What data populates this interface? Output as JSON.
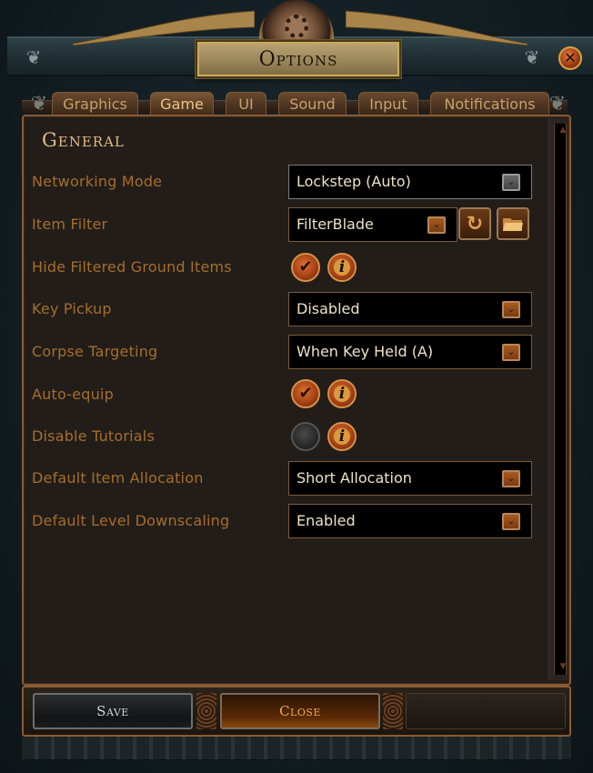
{
  "window": {
    "title": "Options",
    "close_icon": "close-x-icon"
  },
  "tabs": [
    {
      "label": "Graphics",
      "active": false
    },
    {
      "label": "Game",
      "active": true
    },
    {
      "label": "UI",
      "active": false
    },
    {
      "label": "Sound",
      "active": false
    },
    {
      "label": "Input",
      "active": false
    },
    {
      "label": "Notifications",
      "active": false
    }
  ],
  "section": {
    "title": "General"
  },
  "settings": [
    {
      "label": "Networking Mode",
      "type": "dropdown",
      "value": "Lockstep (Auto)",
      "enabled": false
    },
    {
      "label": "Item Filter",
      "type": "dropdown",
      "value": "FilterBlade",
      "enabled": true,
      "extra_buttons": [
        "reload-icon",
        "folder-icon"
      ]
    },
    {
      "label": "Hide Filtered Ground Items",
      "type": "checkbox",
      "checked": true
    },
    {
      "label": "Key Pickup",
      "type": "dropdown",
      "value": "Disabled",
      "enabled": true
    },
    {
      "label": "Corpse Targeting",
      "type": "dropdown",
      "value": "When Key Held (A)",
      "enabled": true
    },
    {
      "label": "Auto-equip",
      "type": "checkbox",
      "checked": true
    },
    {
      "label": "Disable Tutorials",
      "type": "checkbox",
      "checked": false
    },
    {
      "label": "Default Item Allocation",
      "type": "dropdown",
      "value": "Short Allocation",
      "enabled": true
    },
    {
      "label": "Default Level Downscaling",
      "type": "dropdown",
      "value": "Enabled",
      "enabled": true
    }
  ],
  "glyphs": {
    "check": "✔",
    "info": "i",
    "arrow": "⌄",
    "reload": "↻",
    "folder": "📂",
    "close": "✕",
    "scroll_up": "▲",
    "scroll_down": "▼",
    "ornament": "❦"
  },
  "footer": {
    "save_label": "Save",
    "close_label": "Close"
  },
  "colors": {
    "label": "#a66d2d",
    "value_text": "#eee2c6",
    "section_title": "#e1b988",
    "accent_border": "#8a5a32",
    "tab_active_text": "#f0c48a"
  }
}
